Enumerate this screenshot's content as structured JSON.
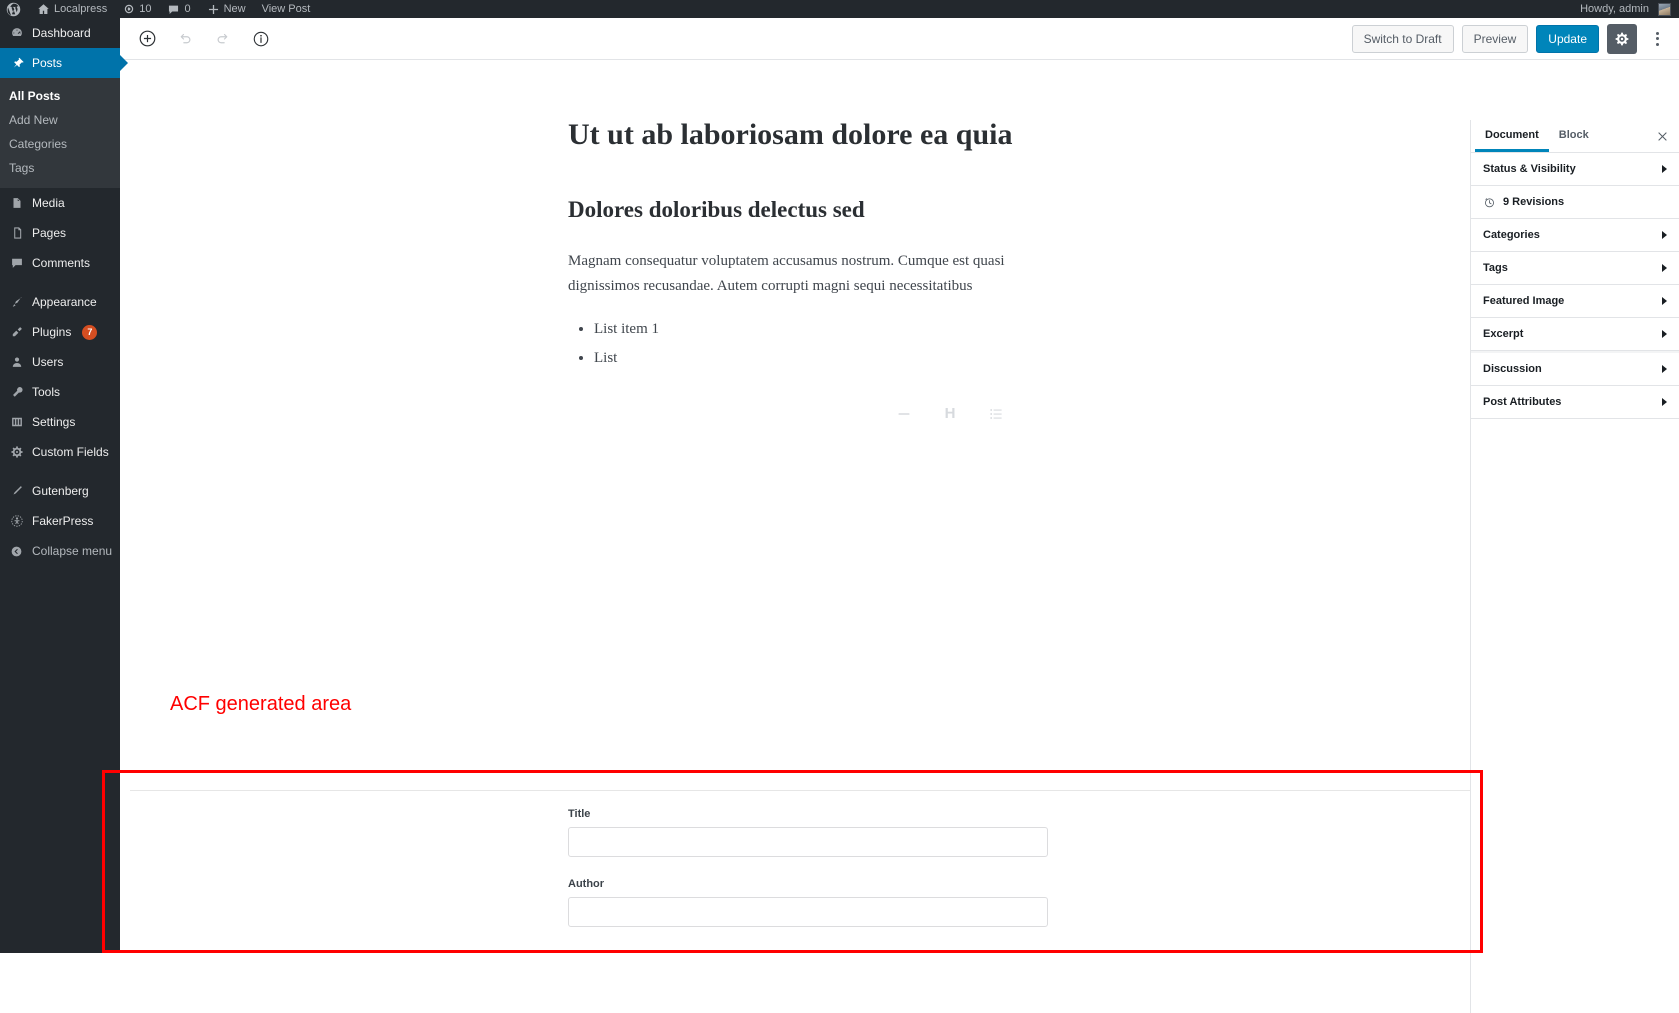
{
  "admin_bar": {
    "logo_icon": "wordpress-logo-icon",
    "site": {
      "icon": "home-icon",
      "label": "Localpress"
    },
    "updates": {
      "icon": "updates-icon",
      "count": "10"
    },
    "comments": {
      "icon": "comment-bubble-icon",
      "count": "0"
    },
    "new": {
      "icon": "plus-icon",
      "label": "New"
    },
    "view_post": {
      "label": "View Post"
    },
    "account": {
      "label": "Howdy, admin",
      "avatar": "user-avatar"
    }
  },
  "admin_menu": {
    "items": [
      {
        "label": "Dashboard",
        "icon": "dashboard-icon",
        "active": false
      },
      {
        "label": "Posts",
        "icon": "pin-icon",
        "active": true
      },
      {
        "label": "Media",
        "icon": "media-icon",
        "active": false
      },
      {
        "label": "Pages",
        "icon": "pages-icon",
        "active": false
      },
      {
        "label": "Comments",
        "icon": "comment-icon",
        "active": false
      },
      {
        "label": "Appearance",
        "icon": "brush-icon",
        "active": false
      },
      {
        "label": "Plugins",
        "icon": "plugin-icon",
        "active": false,
        "badge": "7"
      },
      {
        "label": "Users",
        "icon": "user-icon",
        "active": false
      },
      {
        "label": "Tools",
        "icon": "wrench-icon",
        "active": false
      },
      {
        "label": "Settings",
        "icon": "settings-icon",
        "active": false
      },
      {
        "label": "Custom Fields",
        "icon": "gear-icon",
        "active": false
      },
      {
        "label": "Gutenberg",
        "icon": "pencil-icon",
        "active": false
      },
      {
        "label": "FakerPress",
        "icon": "fakerpress-icon",
        "active": false
      }
    ],
    "posts_submenu": [
      {
        "label": "All Posts",
        "current": true
      },
      {
        "label": "Add New",
        "current": false
      },
      {
        "label": "Categories",
        "current": false
      },
      {
        "label": "Tags",
        "current": false
      }
    ],
    "collapse": {
      "label": "Collapse menu",
      "icon": "collapse-arrow-icon"
    }
  },
  "editor_header": {
    "tools": [
      {
        "name": "add-block-icon",
        "enabled": true
      },
      {
        "name": "undo-icon",
        "enabled": false
      },
      {
        "name": "redo-icon",
        "enabled": false
      },
      {
        "name": "info-icon",
        "enabled": true
      }
    ],
    "switch_to_draft": "Switch to Draft",
    "preview": "Preview",
    "update": "Update",
    "settings_gear": "gear-icon",
    "more_menu": "kebab-menu-icon"
  },
  "post": {
    "title": "Ut ut ab laboriosam dolore ea quia",
    "heading": "Dolores doloribus delectus sed",
    "paragraph": "Magnam consequatur voluptatem accusamus nostrum. Cumque est quasi dignissimos recusandae. Autem corrupti magni sequi necessitatibus",
    "list_items": [
      "List item 1",
      "List"
    ],
    "block_shortcuts": [
      {
        "name": "paragraph-block-icon",
        "glyph": ""
      },
      {
        "name": "heading-block-icon",
        "glyph": "H"
      },
      {
        "name": "list-block-icon",
        "glyph": ""
      }
    ]
  },
  "annotation": {
    "acf_note": "ACF generated area",
    "color": "#ff0000"
  },
  "acf_metabox": {
    "fields": [
      {
        "label": "Title",
        "value": "",
        "placeholder": ""
      },
      {
        "label": "Author",
        "value": "",
        "placeholder": ""
      }
    ]
  },
  "settings_sidebar": {
    "tabs": [
      {
        "label": "Document",
        "active": true
      },
      {
        "label": "Block",
        "active": false
      }
    ],
    "close_icon": "close-icon",
    "panels_top": [
      {
        "label": "Status & Visibility"
      }
    ],
    "revisions": {
      "label": "9 Revisions",
      "icon": "clock-icon"
    },
    "panels": [
      {
        "label": "Categories"
      },
      {
        "label": "Tags"
      },
      {
        "label": "Featured Image"
      },
      {
        "label": "Excerpt"
      },
      {
        "label": "Discussion"
      },
      {
        "label": "Post Attributes"
      }
    ]
  },
  "colors": {
    "admin_dark": "#23282d",
    "admin_submenu": "#32373c",
    "accent_blue": "#0073aa",
    "primary_button": "#0085ba",
    "badge_orange": "#d54e21",
    "annotation_red": "#ff0000"
  }
}
